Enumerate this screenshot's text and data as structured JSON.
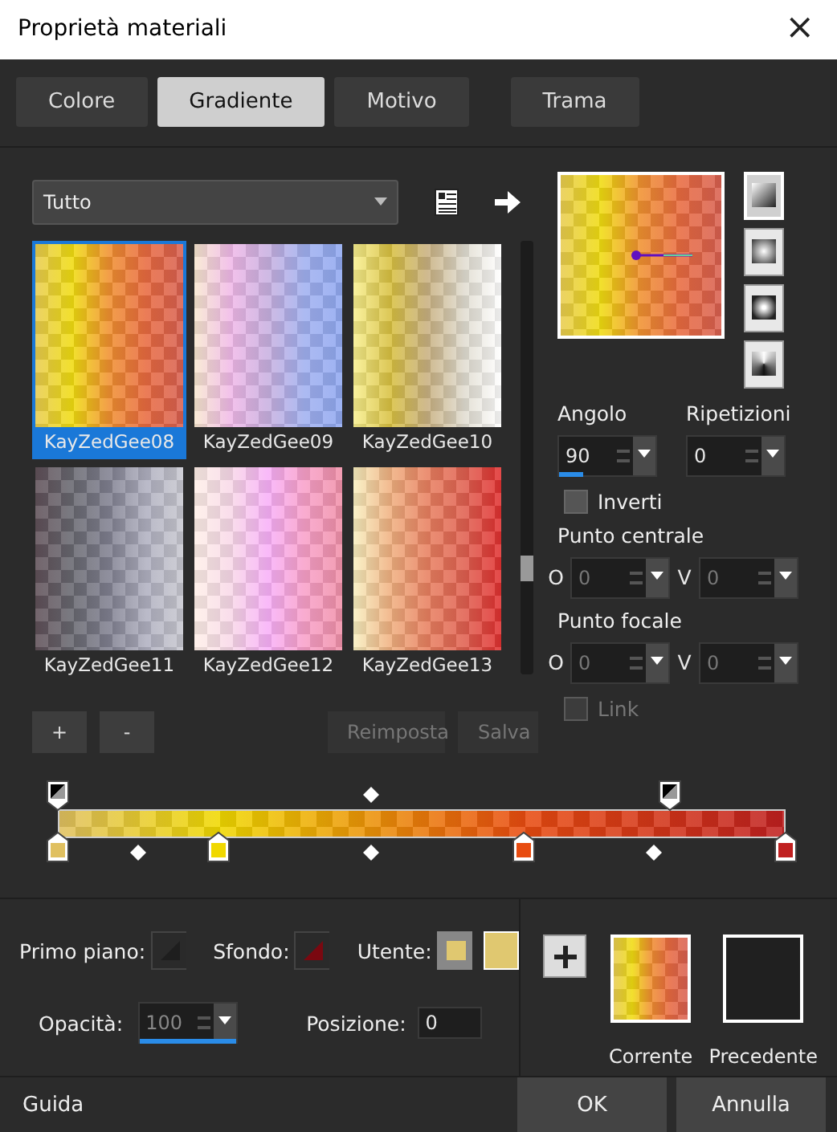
{
  "window": {
    "title": "Proprietà materiali",
    "close": "×"
  },
  "tabs": [
    {
      "label": "Colore",
      "selected": false
    },
    {
      "label": "Gradiente",
      "selected": true
    },
    {
      "label": "Motivo",
      "selected": false
    },
    {
      "label": "Trama",
      "selected": false
    }
  ],
  "category": {
    "value": "Tutto"
  },
  "gradients": [
    {
      "name": "KayZedGee08",
      "selected": true
    },
    {
      "name": "KayZedGee09",
      "selected": false
    },
    {
      "name": "KayZedGee10",
      "selected": false
    },
    {
      "name": "KayZedGee11",
      "selected": false
    },
    {
      "name": "KayZedGee12",
      "selected": false
    },
    {
      "name": "KayZedGee13",
      "selected": false
    }
  ],
  "list_buttons": [
    {
      "label": "+",
      "disabled": false
    },
    {
      "label": "-",
      "disabled": false
    },
    {
      "label": "Reimposta",
      "disabled": true
    },
    {
      "label": "Salva",
      "disabled": true
    }
  ],
  "styles": [
    {
      "kind": "linear",
      "selected": true
    },
    {
      "kind": "rectangular",
      "selected": false
    },
    {
      "kind": "radial",
      "selected": false
    },
    {
      "kind": "sunburst",
      "selected": false
    }
  ],
  "angle": {
    "label": "Angolo",
    "value": "90",
    "level": 0.25
  },
  "repeats": {
    "label": "Ripetizioni",
    "value": "0"
  },
  "invert": {
    "label": "Inverti",
    "checked": false,
    "disabled": false
  },
  "center": {
    "label": "Punto centrale",
    "h_label": "O",
    "h_value": "0",
    "v_label": "V",
    "v_value": "0",
    "disabled": true
  },
  "focal": {
    "label": "Punto focale",
    "h_label": "O",
    "h_value": "0",
    "v_label": "V",
    "v_value": "0",
    "disabled": true
  },
  "link": {
    "label": "Link",
    "checked": false,
    "disabled": true
  },
  "opacity_stops": [
    {
      "level": 0
    },
    {
      "level": 0.84
    }
  ],
  "opacity_midpoints": [
    {
      "level": 0.43
    }
  ],
  "color_stops": [
    {
      "level": 0,
      "color": "#e0c060"
    },
    {
      "level": 0.22,
      "color": "#f0d800"
    },
    {
      "level": 0.64,
      "color": "#e84c10"
    },
    {
      "level": 1,
      "color": "#c02020"
    }
  ],
  "color_midpoints": [
    {
      "level": 0.11
    },
    {
      "level": 0.43
    },
    {
      "level": 0.82
    }
  ],
  "foreground": {
    "label": "Primo piano:",
    "color": "#1e1e1e"
  },
  "background": {
    "label": "Sfondo:",
    "color": "#7a0810"
  },
  "user": {
    "label": "Utente:",
    "color": "#e0c870"
  },
  "opacity": {
    "label": "Opacità:",
    "value": "100",
    "level": 1
  },
  "position": {
    "label": "Posizione:",
    "value": "0"
  },
  "current": {
    "label": "Corrente"
  },
  "previous": {
    "label": "Precedente",
    "color": "#202020"
  },
  "footer": {
    "help": "Guida",
    "ok": "OK",
    "cancel": "Annulla"
  }
}
